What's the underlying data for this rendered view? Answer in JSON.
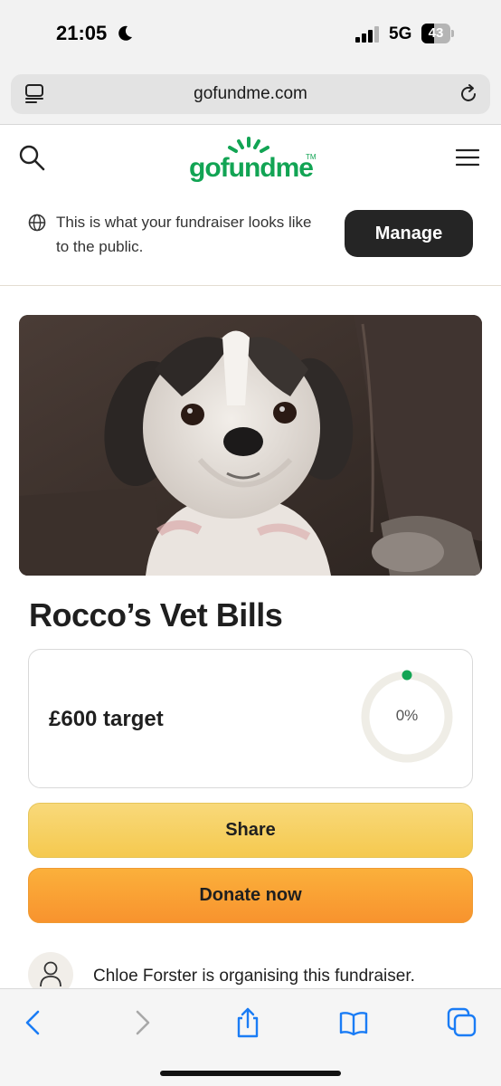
{
  "status_bar": {
    "time": "21:05",
    "network": "5G",
    "battery_level": "43",
    "icons": [
      "moon-icon",
      "signal-icon",
      "battery-icon"
    ]
  },
  "browser": {
    "url": "gofundme.com",
    "icons": [
      "reader-icon",
      "reload-icon"
    ]
  },
  "header": {
    "logo_text": "gofundme",
    "logo_tm": "TM",
    "icons": [
      "search-icon",
      "menu-icon"
    ]
  },
  "notice": {
    "text": "This is what your fundraiser looks like to the public.",
    "manage_label": "Manage"
  },
  "campaign": {
    "title": "Rocco’s Vet Bills",
    "target": "£600 target",
    "progress_label": "0%",
    "progress_fraction": 0
  },
  "actions": {
    "share_label": "Share",
    "donate_label": "Donate now"
  },
  "organiser": {
    "text": "Chloe Forster is organising this fundraiser."
  },
  "toolbar": {
    "icons": [
      "back-icon",
      "forward-icon",
      "share-icon",
      "bookmarks-icon",
      "tabs-icon"
    ]
  },
  "colors": {
    "brand_green": "#12a454",
    "share_yellow": "#f7d05d",
    "donate_orange": "#f9a134",
    "ios_blue": "#1a7cf5",
    "manage_dark": "#252525"
  }
}
